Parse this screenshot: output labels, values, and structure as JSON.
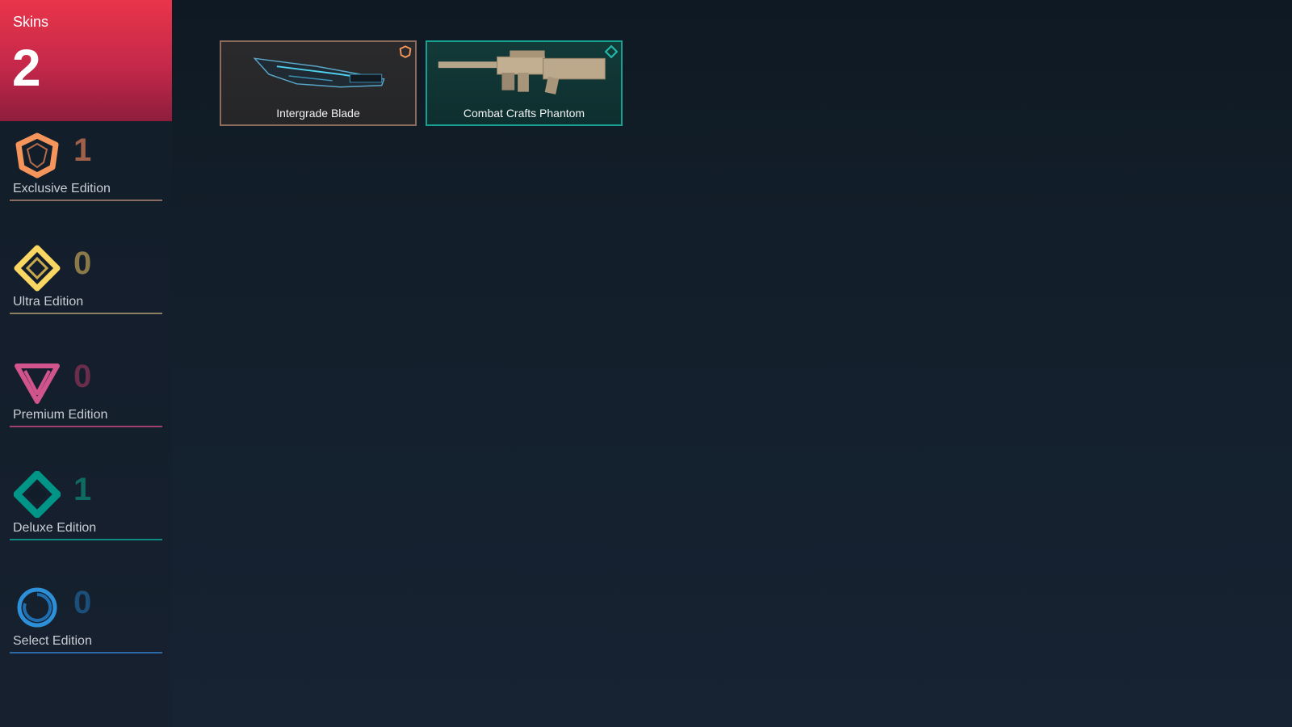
{
  "summary": {
    "label": "Skins",
    "count": "2"
  },
  "tiers": [
    {
      "name": "Exclusive Edition",
      "count": "1",
      "icon": "exclusive-edition-icon",
      "color": "#f5955b",
      "count_color": "#a0604a",
      "line_color": "#8c6b61"
    },
    {
      "name": "Ultra Edition",
      "count": "0",
      "icon": "ultra-edition-icon",
      "color": "#fad663",
      "count_color": "#8a7a4a",
      "line_color": "#8a8060"
    },
    {
      "name": "Premium Edition",
      "count": "0",
      "icon": "premium-edition-icon",
      "color": "#d1548d",
      "count_color": "#6a2e4c",
      "line_color": "#a04070"
    },
    {
      "name": "Deluxe Edition",
      "count": "1",
      "icon": "deluxe-edition-icon",
      "color": "#009587",
      "count_color": "#0f6a62",
      "line_color": "#0f8a80"
    },
    {
      "name": "Select Edition",
      "count": "0",
      "icon": "select-edition-icon",
      "color": "#2d8fd8",
      "count_color": "#1c4e7a",
      "line_color": "#2a6aa8"
    }
  ],
  "skins": [
    {
      "name": "Intergrade Blade",
      "tier": "Exclusive Edition",
      "border_color": "#8d6b5c",
      "badge": "exclusive-edition-icon"
    },
    {
      "name": "Combat Crafts Phantom",
      "tier": "Deluxe Edition",
      "border_color": "#16a08f",
      "badge": "deluxe-edition-icon"
    }
  ]
}
